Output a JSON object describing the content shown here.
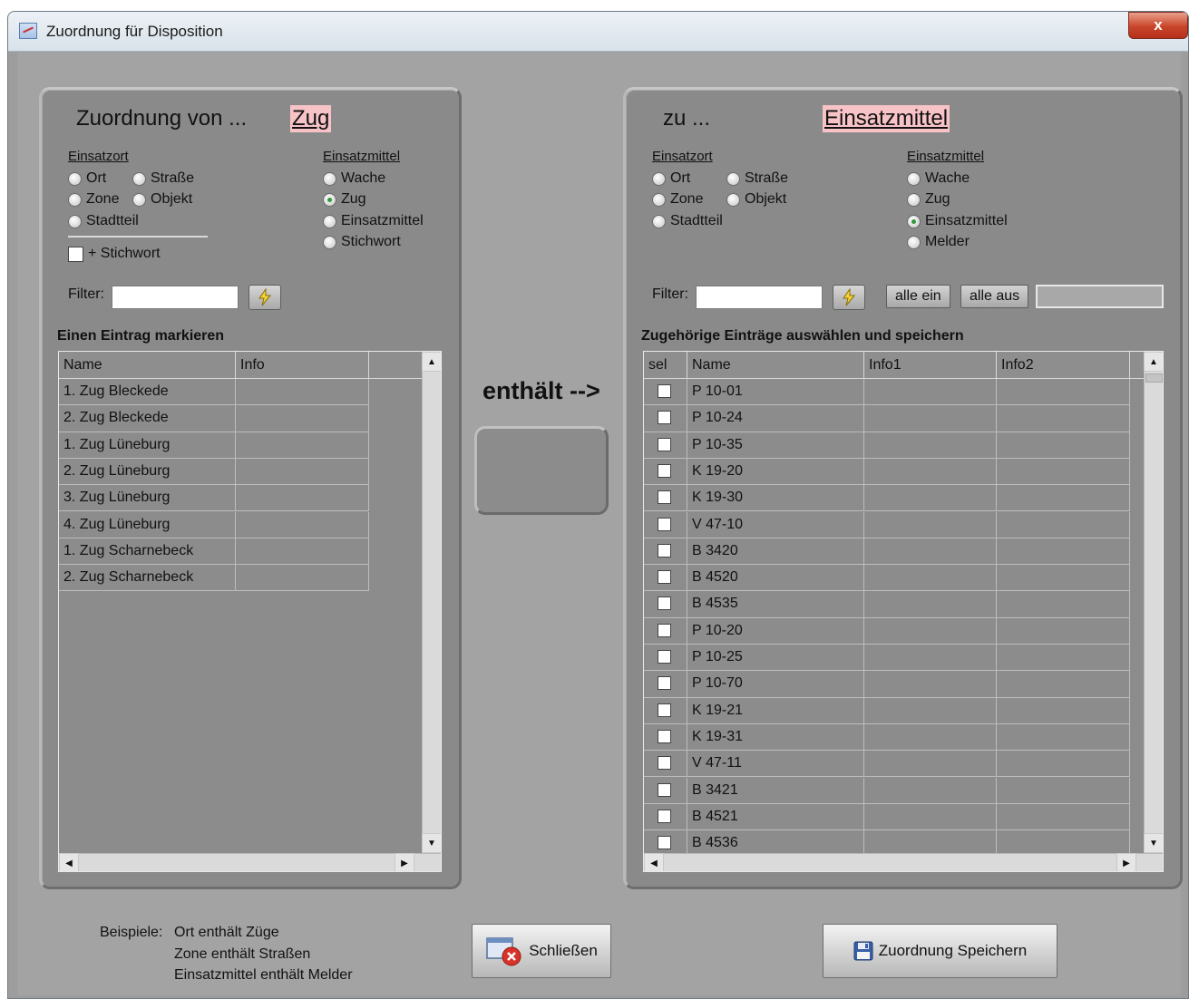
{
  "window": {
    "title": "Zuordnung für Disposition",
    "close_label": "x"
  },
  "left": {
    "heading": "Zuordnung von ...",
    "tag": "Zug",
    "einsatzort_label": "Einsatzort",
    "einsatzort_options": [
      "Ort",
      "Straße",
      "Zone",
      "Objekt",
      "Stadtteil"
    ],
    "einsatzmittel_label": "Einsatzmittel",
    "einsatzmittel_options": [
      "Wache",
      "Zug",
      "Einsatzmittel",
      "Stichwort"
    ],
    "selected_option": "Zug",
    "stichwort_checkbox": "+ Stichwort",
    "filter_label": "Filter:",
    "filter_value": "",
    "list_title": "Einen Eintrag markieren",
    "columns": [
      "Name",
      "Info"
    ],
    "rows": [
      {
        "name": "1. Zug Bleckede",
        "info": ""
      },
      {
        "name": "2. Zug Bleckede",
        "info": ""
      },
      {
        "name": "1. Zug Lüneburg",
        "info": ""
      },
      {
        "name": "2. Zug Lüneburg",
        "info": ""
      },
      {
        "name": "3. Zug Lüneburg",
        "info": ""
      },
      {
        "name": "4. Zug Lüneburg",
        "info": ""
      },
      {
        "name": "1. Zug Scharnebeck",
        "info": ""
      },
      {
        "name": "2. Zug Scharnebeck",
        "info": ""
      }
    ]
  },
  "middle": {
    "relation_label": "enthält -->"
  },
  "right": {
    "heading": "zu ...",
    "tag": "Einsatzmittel",
    "einsatzort_label": "Einsatzort",
    "einsatzort_options": [
      "Ort",
      "Straße",
      "Zone",
      "Objekt",
      "Stadtteil"
    ],
    "einsatzmittel_label": "Einsatzmittel",
    "einsatzmittel_options": [
      "Wache",
      "Zug",
      "Einsatzmittel",
      "Melder"
    ],
    "selected_option": "Einsatzmittel",
    "filter_label": "Filter:",
    "filter_value": "",
    "all_on_label": "alle ein",
    "all_off_label": "alle aus",
    "list_title": "Zugehörige Einträge auswählen und speichern",
    "columns": [
      "sel",
      "Name",
      "Info1",
      "Info2"
    ],
    "rows": [
      {
        "sel": false,
        "name": "P 10-01",
        "info1": "",
        "info2": ""
      },
      {
        "sel": false,
        "name": "P 10-24",
        "info1": "",
        "info2": ""
      },
      {
        "sel": false,
        "name": "P 10-35",
        "info1": "",
        "info2": ""
      },
      {
        "sel": false,
        "name": "K 19-20",
        "info1": "",
        "info2": ""
      },
      {
        "sel": false,
        "name": "K 19-30",
        "info1": "",
        "info2": ""
      },
      {
        "sel": false,
        "name": "V 47-10",
        "info1": "",
        "info2": ""
      },
      {
        "sel": false,
        "name": "B 3420",
        "info1": "",
        "info2": ""
      },
      {
        "sel": false,
        "name": "B 4520",
        "info1": "",
        "info2": ""
      },
      {
        "sel": false,
        "name": "B 4535",
        "info1": "",
        "info2": ""
      },
      {
        "sel": false,
        "name": "P 10-20",
        "info1": "",
        "info2": ""
      },
      {
        "sel": false,
        "name": "P 10-25",
        "info1": "",
        "info2": ""
      },
      {
        "sel": false,
        "name": "P 10-70",
        "info1": "",
        "info2": ""
      },
      {
        "sel": false,
        "name": "K 19-21",
        "info1": "",
        "info2": ""
      },
      {
        "sel": false,
        "name": "K 19-31",
        "info1": "",
        "info2": ""
      },
      {
        "sel": false,
        "name": "V 47-11",
        "info1": "",
        "info2": ""
      },
      {
        "sel": false,
        "name": "B 3421",
        "info1": "",
        "info2": ""
      },
      {
        "sel": false,
        "name": "B 4521",
        "info1": "",
        "info2": ""
      },
      {
        "sel": false,
        "name": "B 4536",
        "info1": "",
        "info2": ""
      }
    ]
  },
  "footer": {
    "examples_label": "Beispiele:",
    "examples": [
      "Ort enthält Züge",
      "Zone enthält Straßen",
      "Einsatzmittel enthält Melder"
    ],
    "close_button": "Schließen",
    "save_button": "Zuordnung Speichern"
  },
  "colors": {
    "panel": "#8a8a8a",
    "background": "#a3a3a3",
    "tag_highlight": "#f7c3c7",
    "radio_checked": "#2f9a3a"
  },
  "icons": {
    "filter": "lightning-filter-icon",
    "close": "window-close-icon",
    "save": "floppy-disk-icon"
  }
}
